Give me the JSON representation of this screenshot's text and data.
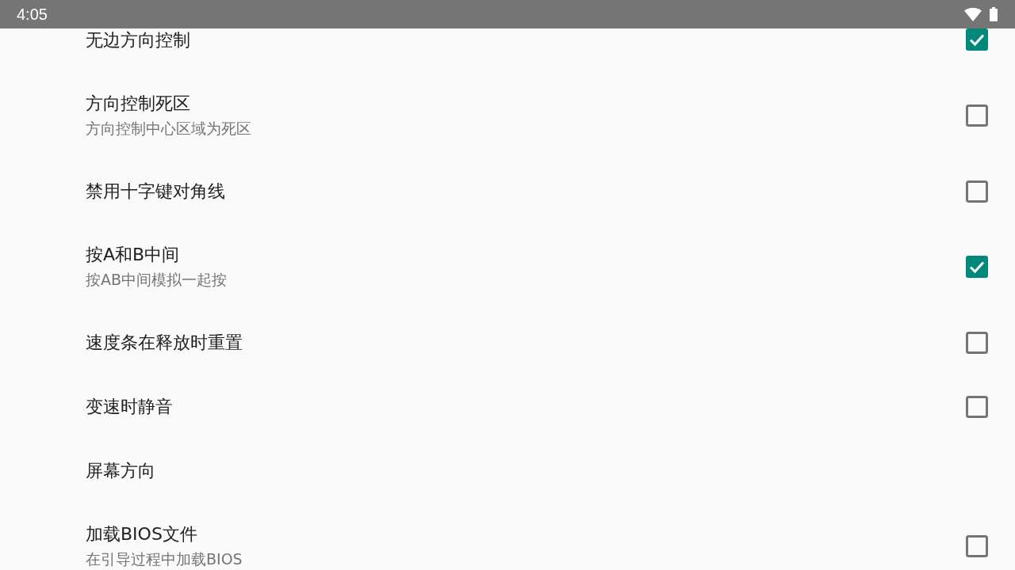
{
  "status_bar": {
    "time": "4:05"
  },
  "settings": [
    {
      "kind": "checkbox",
      "title": "无边方向控制",
      "checked": true
    },
    {
      "kind": "checkbox",
      "title": "方向控制死区",
      "summary": "方向控制中心区域为死区",
      "checked": false
    },
    {
      "kind": "checkbox",
      "title": "禁用十字键对角线",
      "checked": false
    },
    {
      "kind": "checkbox",
      "title": "按A和B中间",
      "summary": "按AB中间模拟一起按",
      "checked": true
    },
    {
      "kind": "checkbox",
      "title": "速度条在释放时重置",
      "checked": false
    },
    {
      "kind": "checkbox",
      "title": "变速时静音",
      "checked": false
    },
    {
      "kind": "plain",
      "title": "屏幕方向"
    },
    {
      "kind": "checkbox",
      "title": "加载BIOS文件",
      "summary": "在引导过程中加载BIOS",
      "checked": false
    }
  ]
}
